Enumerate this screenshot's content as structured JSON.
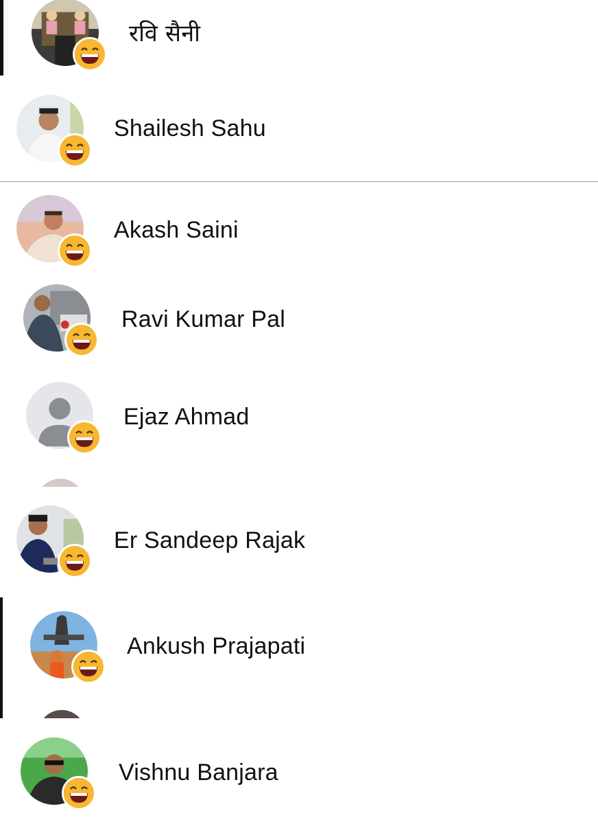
{
  "contacts": [
    {
      "name": "रवि सैनी",
      "avatar": "photo-avatar",
      "reaction": "laughing-emoji"
    },
    {
      "name": "Shailesh Sahu",
      "avatar": "photo-avatar",
      "reaction": "laughing-emoji"
    },
    {
      "name": "Akash Saini",
      "avatar": "photo-avatar",
      "reaction": "laughing-emoji"
    },
    {
      "name": "Ravi Kumar Pal",
      "avatar": "photo-avatar",
      "reaction": "laughing-emoji"
    },
    {
      "name": "Ejaz Ahmad",
      "avatar": "default-person-avatar",
      "reaction": "laughing-emoji"
    },
    {
      "name": "Er Sandeep Rajak",
      "avatar": "photo-avatar",
      "reaction": "laughing-emoji"
    },
    {
      "name": "Ankush Prajapati",
      "avatar": "photo-avatar",
      "reaction": "laughing-emoji"
    },
    {
      "name": "Vishnu Banjara",
      "avatar": "photo-avatar",
      "reaction": "laughing-emoji"
    }
  ],
  "colors": {
    "background": "#ffffff",
    "text": "#111111",
    "divider": "#9e9e9e",
    "emoji_face": "#f7b731",
    "emoji_mouth": "#6b1a1a",
    "default_avatar_bg": "#e4e6eb",
    "default_avatar_fg": "#8a8d91"
  }
}
